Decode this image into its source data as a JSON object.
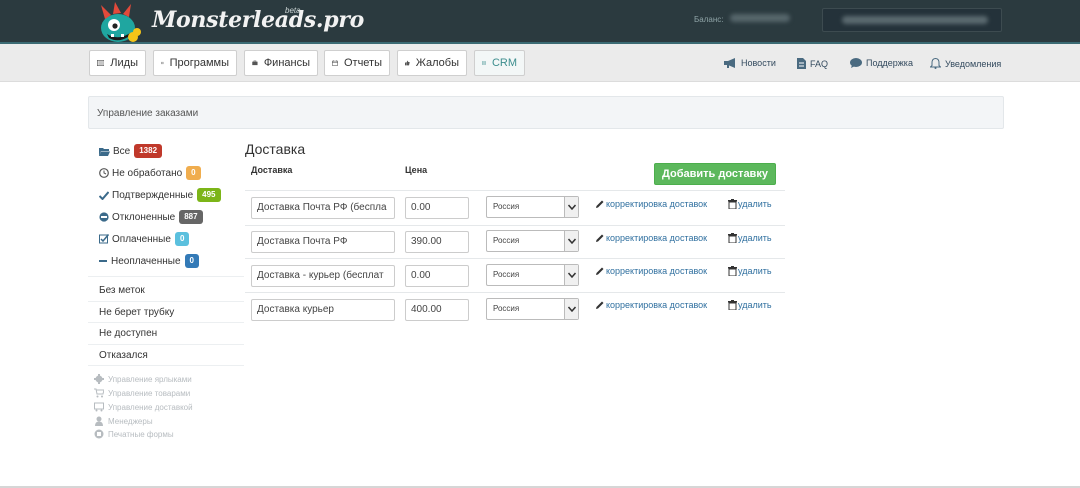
{
  "header": {
    "logo_text": "Monsterleads.pro",
    "logo_beta": "beta",
    "balance_label": "Баланс:"
  },
  "nav": {
    "items": [
      {
        "label": "Лиды",
        "icon": "list-icon"
      },
      {
        "label": "Программы",
        "icon": "list-icon"
      },
      {
        "label": "Финансы",
        "icon": "briefcase-icon"
      },
      {
        "label": "Отчеты",
        "icon": "calendar-icon"
      },
      {
        "label": "Жалобы",
        "icon": "thumbs-up-icon"
      },
      {
        "label": "CRM",
        "icon": "list-icon",
        "active": true
      }
    ],
    "right": [
      {
        "label": "Новости",
        "icon": "megaphone-icon"
      },
      {
        "label": "FAQ",
        "icon": "document-icon"
      },
      {
        "label": "Поддержка",
        "icon": "chat-icon"
      },
      {
        "label": "Уведомления",
        "icon": "bell-icon"
      }
    ]
  },
  "panel": {
    "title": "Управление заказами"
  },
  "sidebar": {
    "statuses": [
      {
        "label": "Все",
        "count": "1382",
        "color": "#c0392b",
        "icon": "folder-open-icon"
      },
      {
        "label": "Не обработано",
        "count": "0",
        "color": "#f0ad4e",
        "icon": "clock-icon"
      },
      {
        "label": "Подтвержденные",
        "count": "495",
        "color": "#7cb518",
        "icon": "check-icon"
      },
      {
        "label": "Отклоненные",
        "count": "887",
        "color": "#666666",
        "icon": "minus-circle-icon"
      },
      {
        "label": "Оплаченные",
        "count": "0",
        "color": "#5bc0de",
        "icon": "checkbox-icon"
      },
      {
        "label": "Неоплаченные",
        "count": "0",
        "color": "#337ab7",
        "icon": "minus-icon"
      }
    ],
    "tags": [
      "Без меток",
      "Не берет трубку",
      "Не доступен",
      "Отказался"
    ],
    "management": [
      {
        "label": "Управление ярлыками",
        "icon": "gear-icon"
      },
      {
        "label": "Управление товарами",
        "icon": "cart-icon"
      },
      {
        "label": "Управление доставкой",
        "icon": "truck-icon"
      },
      {
        "label": "Менеджеры",
        "icon": "user-icon"
      },
      {
        "label": "Печатные формы",
        "icon": "print-icon"
      }
    ]
  },
  "main": {
    "title": "Доставка",
    "col_delivery": "Доставка",
    "col_price": "Цена",
    "add_button": "Добавить доставку",
    "edit_label": "корректировка доставок",
    "delete_label": "удалить",
    "rows": [
      {
        "name": "Доставка Почта РФ (беспла",
        "price": "0.00",
        "country": "Россия"
      },
      {
        "name": "Доставка Почта РФ",
        "price": "390.00",
        "country": "Россия"
      },
      {
        "name": "Доставка - курьер (бесплат",
        "price": "0.00",
        "country": "Россия"
      },
      {
        "name": "Доставка курьер",
        "price": "400.00",
        "country": "Россия"
      }
    ]
  },
  "colors": {
    "header_bg": "#2b3a3f",
    "accent_green": "#5cb85c",
    "link_blue": "#2f6f9f"
  }
}
